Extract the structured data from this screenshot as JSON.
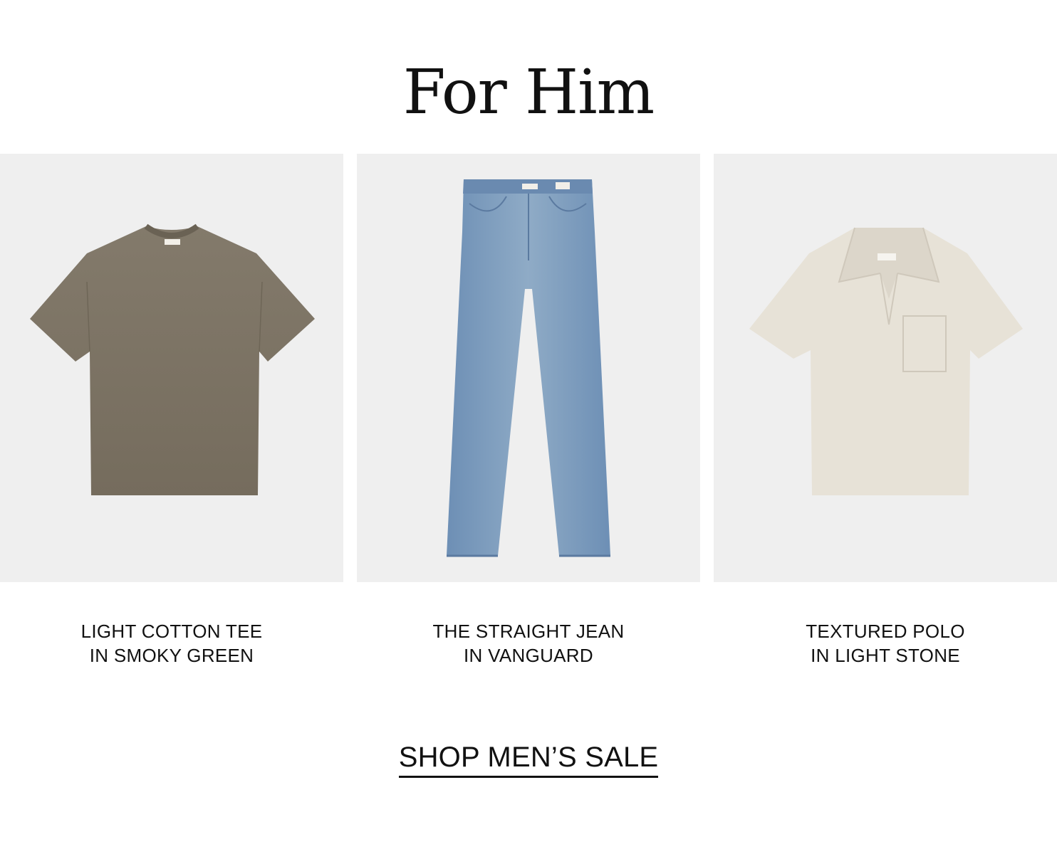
{
  "section": {
    "title": "For Him"
  },
  "products": [
    {
      "line1": "LIGHT COTTON TEE",
      "line2": "IN SMOKY GREEN",
      "image": "tshirt-image",
      "color": "#7d7464"
    },
    {
      "line1": "THE STRAIGHT JEAN",
      "line2": "IN VANGUARD",
      "image": "jeans-image",
      "color": "#7f9bbb"
    },
    {
      "line1": "TEXTURED POLO",
      "line2": "IN LIGHT STONE",
      "image": "polo-image",
      "color": "#e6e0d5"
    }
  ],
  "cta": {
    "label": "SHOP MEN’S SALE"
  },
  "colors": {
    "background": "#ffffff",
    "image_background": "#efefef",
    "text": "#111111"
  }
}
